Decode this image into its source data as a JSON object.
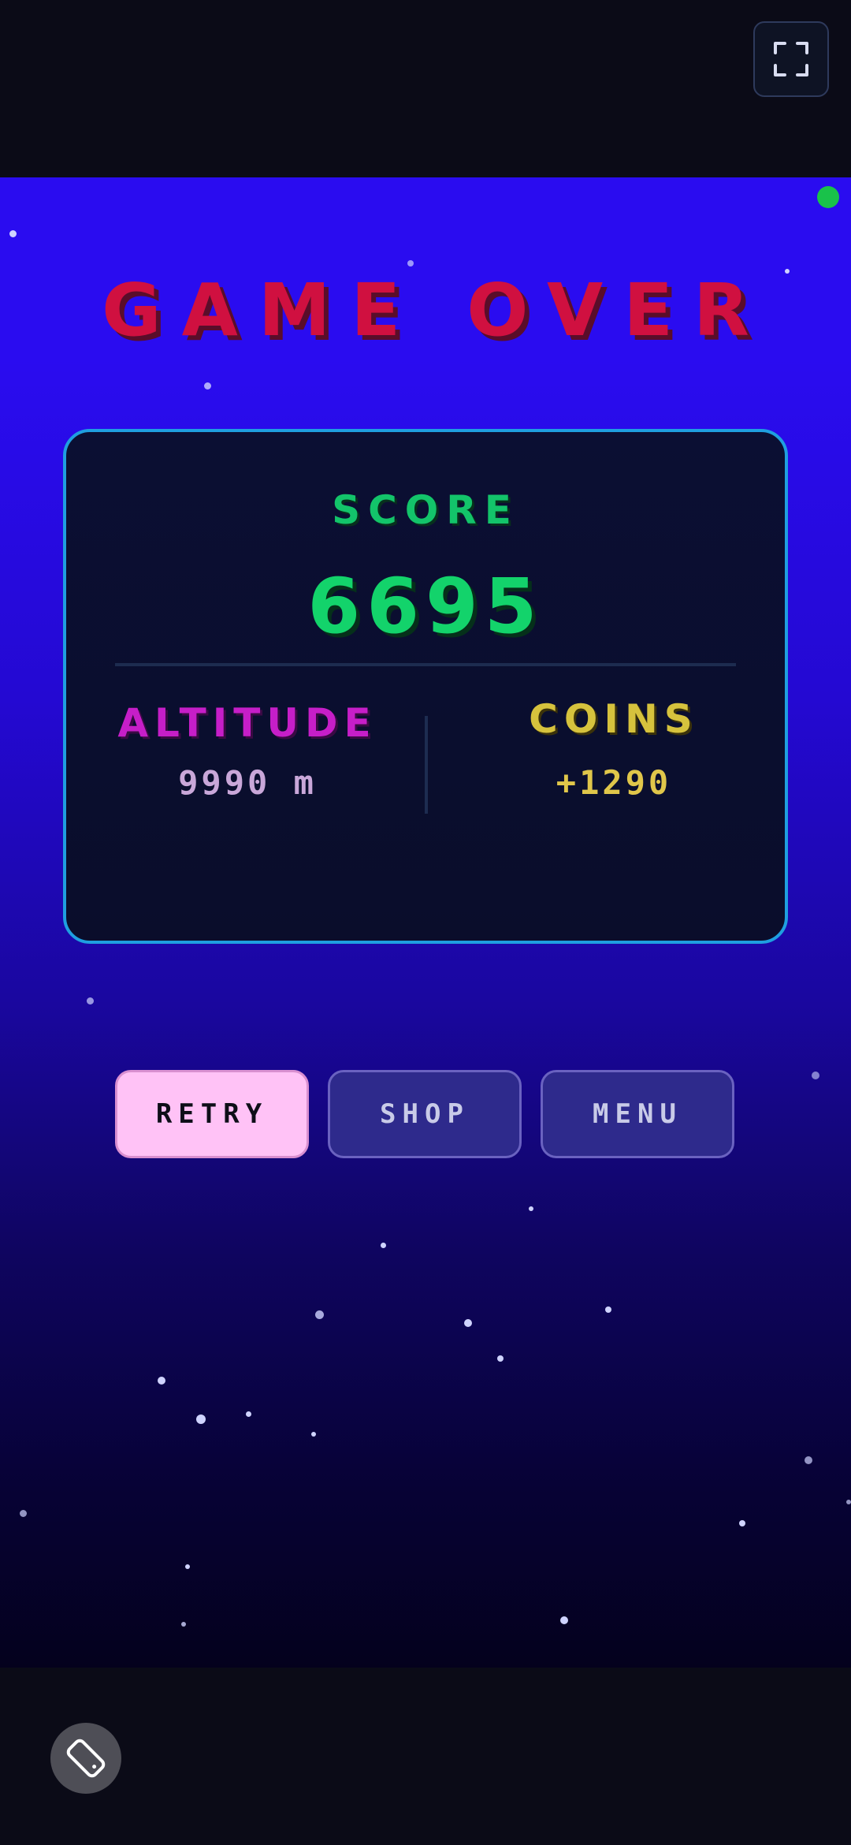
{
  "game_over": {
    "title": "GAME OVER"
  },
  "score_panel": {
    "score_label": "SCORE",
    "score_value": "6695",
    "altitude_label": "ALTITUDE",
    "altitude_value": "9990 m",
    "coins_label": "COINS",
    "coins_value": "+1290"
  },
  "buttons": {
    "retry": "RETRY",
    "shop": "SHOP",
    "menu": "MENU"
  },
  "icons": {
    "fullscreen": "fullscreen-icon",
    "rotate": "rotate-device-icon",
    "status": "status-dot"
  },
  "colors": {
    "title": "#d01040",
    "score": "#13d36b",
    "altitude": "#c61ec8",
    "coins": "#d6c23d",
    "panel_border": "#1f9fe0",
    "retry_bg": "#ffc2f6",
    "secondary_button_bg": "#2e2a8c",
    "status_dot": "#19c24a"
  }
}
